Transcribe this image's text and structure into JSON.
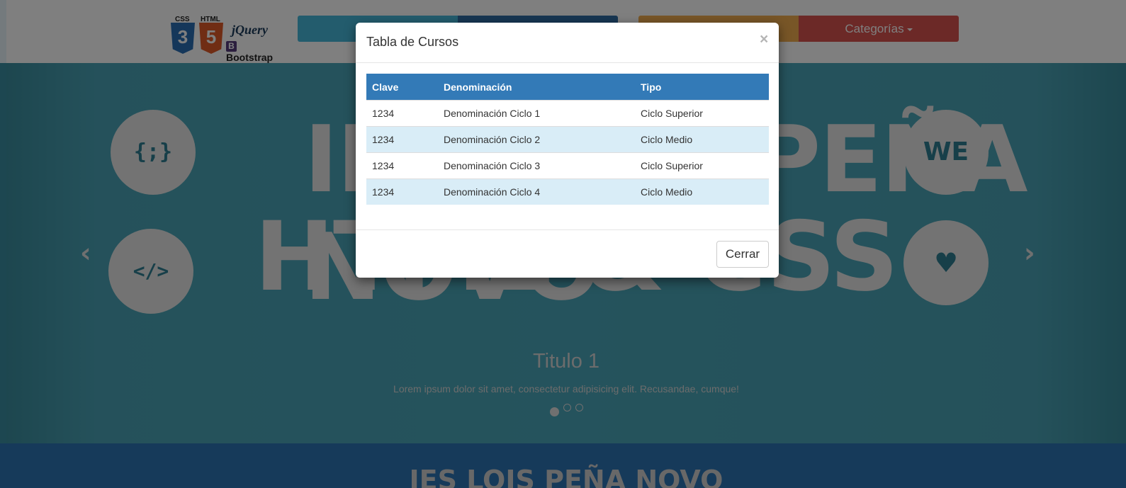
{
  "navbar": {
    "logo": {
      "css_label": "CSS",
      "html_label": "HTML",
      "css_number": "3",
      "html_number": "5",
      "jquery": "jQuery",
      "bootstrap_badge": "B",
      "bootstrap": "Bootstrap"
    },
    "buttons": [
      {
        "label": ""
      },
      {
        "label": ""
      },
      {
        "label": ""
      },
      {
        "label": "Categorías"
      }
    ]
  },
  "carousel": {
    "bigtext_line1": "IES LOIS PEÑA NOVO",
    "bigtext_line2": "HTML & CSS",
    "circles": [
      {
        "glyph": "{;}",
        "icon": "braces-icon"
      },
      {
        "glyph": "</>",
        "icon": "code-icon"
      },
      {
        "glyph": "WE",
        "icon": "we-icon"
      },
      {
        "glyph": "♥",
        "icon": "heart-icon"
      }
    ],
    "prev_glyph": "‹",
    "next_glyph": "›",
    "caption_title": "Titulo 1",
    "caption_text": "Lorem ipsum dolor sit amet, consectetur adipisicing elit. Recusandae, cumque!",
    "indicators": 3,
    "active_indicator": 1
  },
  "section": {
    "title": "IES LOIS PEÑA NOVO"
  },
  "modal": {
    "title": "Tabla de Cursos",
    "close_glyph": "×",
    "table": {
      "headers": [
        "Clave",
        "Denominación",
        "Tipo"
      ],
      "rows": [
        [
          "1234",
          "Denominación Ciclo 1",
          "Ciclo Superior"
        ],
        [
          "1234",
          "Denominación Ciclo 2",
          "Ciclo Medio"
        ],
        [
          "1234",
          "Denominación Ciclo 3",
          "Ciclo Superior"
        ],
        [
          "1234",
          "Denominación Ciclo 4",
          "Ciclo Medio"
        ]
      ]
    },
    "close_button_label": "Cerrar"
  },
  "colors": {
    "primary": "#337ab7",
    "info": "#5bc0de",
    "warning": "#f0ad4e",
    "danger": "#d9534f",
    "row_highlight": "#d9edf7"
  }
}
